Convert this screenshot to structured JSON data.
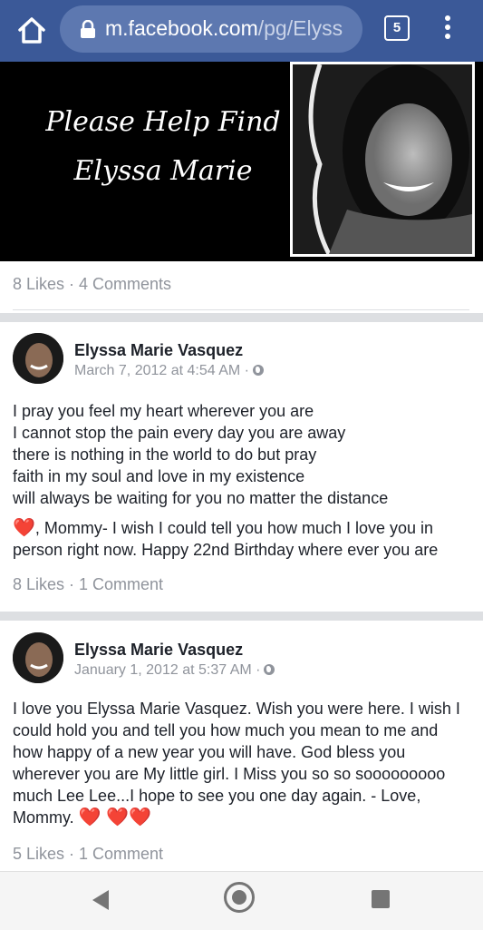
{
  "browser": {
    "url_host": "m.facebook.com",
    "url_path": "/pg/Elyss",
    "tab_count": "5",
    "icons": {
      "home": "home-icon",
      "lock": "lock-icon",
      "tabs": "tabs-icon",
      "menu": "overflow-menu-icon"
    },
    "bar_color": "#3b5998"
  },
  "banner": {
    "line1": "Please Help Find",
    "line2": "Elyssa Marie",
    "stats": "8 Likes · 4 Comments"
  },
  "posts": [
    {
      "author": "Elyssa Marie Vasquez",
      "date": "March 7, 2012 at 4:54 AM ·",
      "text": "I pray you feel my heart wherever you are\nI cannot stop the pain every day you are away\nthere is nothing in the world to do but pray\nfaith in my soul and love in my existence\nwill always be waiting for you no matter the distance",
      "text2": ", Mommy- I wish I could tell you how much I love you in person right now. Happy 22nd Birthday where ever you are",
      "stats": "8 Likes · 1 Comment"
    },
    {
      "author": "Elyssa Marie Vasquez",
      "date": "January 1, 2012 at 5:37 AM ·",
      "text": "I love you Elyssa Marie Vasquez. Wish you were here. I wish I could hold you and tell you how much you mean to me and how happy of a new year you will have. God bless you wherever you are My little girl. I Miss you so so sooooooooo much Lee Lee...I hope to see you one day again. - Love, Mommy.",
      "stats": "5 Likes · 1 Comment"
    }
  ],
  "hearts": {
    "single": "❤️",
    "triple": "❤️ ❤️❤️"
  },
  "navbar": {
    "icons": [
      "back-icon",
      "home-circle-icon",
      "recent-apps-icon"
    ]
  }
}
